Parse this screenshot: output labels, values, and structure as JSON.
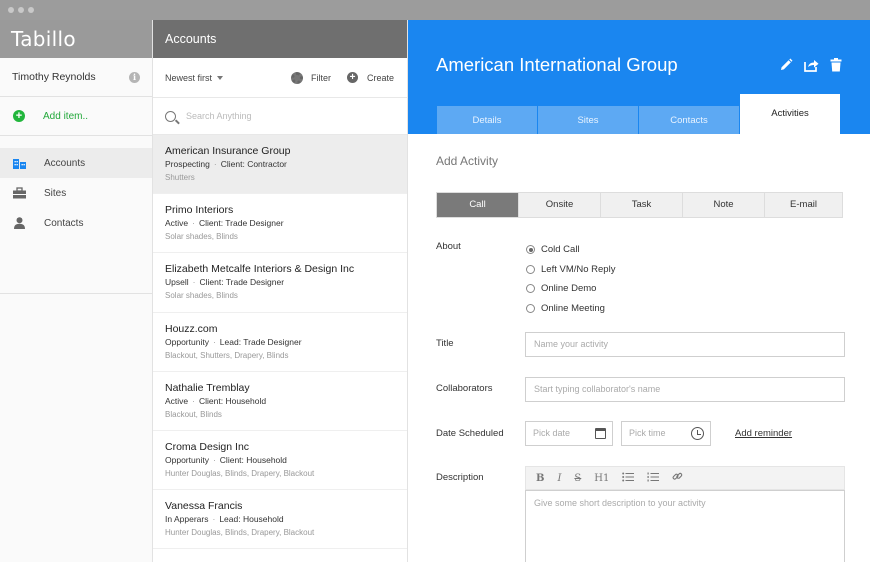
{
  "app": {
    "brand": "Tabillo"
  },
  "sidebar": {
    "user_name": "Timothy Reynolds",
    "add_item_label": "Add item..",
    "items": [
      {
        "label": "Accounts",
        "icon": "building-icon",
        "active": true
      },
      {
        "label": "Sites",
        "icon": "briefcase-icon",
        "active": false
      },
      {
        "label": "Contacts",
        "icon": "person-icon",
        "active": false
      }
    ]
  },
  "accounts": {
    "title": "Accounts",
    "sort_label": "Newest first",
    "filter_label": "Filter",
    "create_label": "Create",
    "search_placeholder": "Search Anything",
    "items": [
      {
        "name": "American Insurance Group",
        "status": "Prospecting",
        "type": "Client: Contractor",
        "tags": "Shutters",
        "selected": true
      },
      {
        "name": "Primo Interiors",
        "status": "Active",
        "type": "Client: Trade Designer",
        "tags": "Solar shades, Blinds",
        "selected": false
      },
      {
        "name": "Elizabeth Metcalfe Interiors & Design Inc",
        "status": "Upsell",
        "type": "Client: Trade Designer",
        "tags": "Solar shades, Blinds",
        "selected": false
      },
      {
        "name": "Houzz.com",
        "status": "Opportunity",
        "type": "Lead: Trade Designer",
        "tags": "Blackout, Shutters, Drapery, Blinds",
        "selected": false
      },
      {
        "name": "Nathalie Tremblay",
        "status": "Active",
        "type": "Client: Household",
        "tags": "Blackout, Blinds",
        "selected": false
      },
      {
        "name": "Croma Design Inc",
        "status": "Opportunity",
        "type": "Client: Household",
        "tags": "Hunter Douglas, Blinds, Drapery, Blackout",
        "selected": false
      },
      {
        "name": "Vanessa Francis",
        "status": "In Apperars",
        "type": "Lead: Household",
        "tags": "Hunter Douglas, Blinds, Drapery, Blackout",
        "selected": false
      }
    ]
  },
  "detail": {
    "title": "American International Group",
    "tabs": [
      "Details",
      "Sites",
      "Contacts",
      "Activities"
    ],
    "active_tab": "Activities",
    "form_title": "Add Activity",
    "activity_types": [
      "Call",
      "Onsite",
      "Task",
      "Note",
      "E-mail"
    ],
    "active_type": "Call",
    "about_label": "About",
    "about_options": [
      "Cold Call",
      "Left VM/No Reply",
      "Online Demo",
      "Online Meeting"
    ],
    "about_selected": "Cold Call",
    "title_label": "Title",
    "title_placeholder": "Name your activity",
    "collaborators_label": "Collaborators",
    "collaborators_placeholder": "Start typing collaborator's name",
    "date_label": "Date Scheduled",
    "date_placeholder": "Pick date",
    "time_placeholder": "Pick time",
    "add_reminder_label": "Add reminder",
    "description_label": "Description",
    "editor_tools": [
      "B",
      "I",
      "S",
      "H1"
    ],
    "description_placeholder": "Give some short description to your activity"
  },
  "colors": {
    "accent": "#1a86f0",
    "success": "#22b63c"
  }
}
